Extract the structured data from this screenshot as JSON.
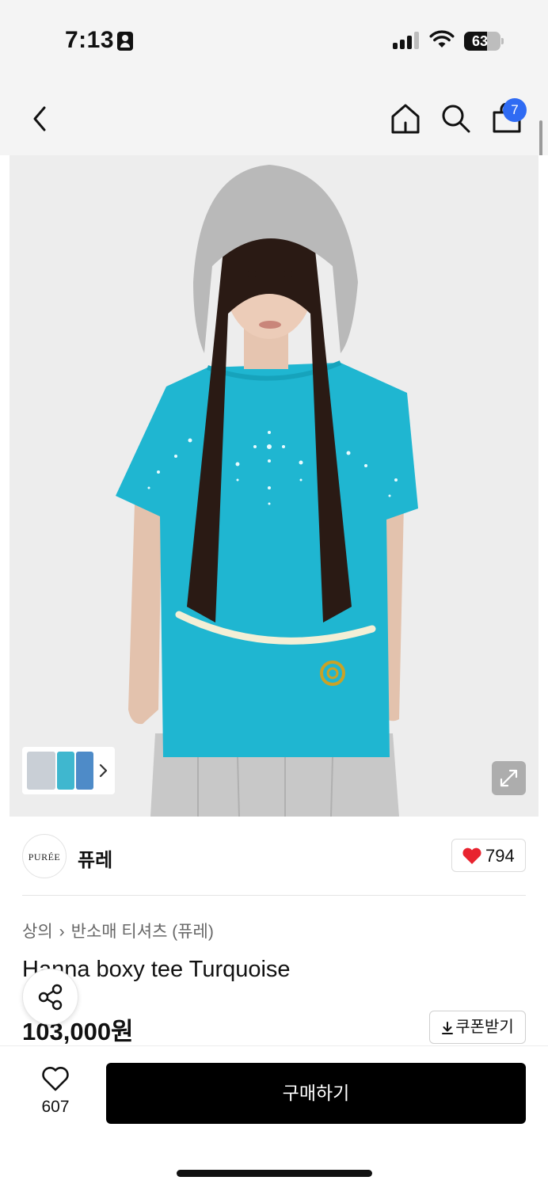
{
  "status_bar": {
    "time": "7:13",
    "battery": "63",
    "battery_level": 0.63
  },
  "nav": {
    "cart_badge": "7"
  },
  "brand": {
    "logo_text": "PURÉE",
    "name": "퓨레",
    "like_count": "794"
  },
  "product": {
    "breadcrumb": [
      "상의",
      "반소매 티셔츠 (퓨레)"
    ],
    "title": "Hanna boxy tee Turquoise",
    "price": "103,000원",
    "coupon_label": "쿠폰받기"
  },
  "bottom": {
    "wish_count": "607",
    "buy_label": "구매하기"
  },
  "colors": {
    "accent_blue": "#2f6bf3",
    "heart_red": "#e8232f",
    "shirt_turquoise": "#1fb6d1",
    "buy_button": "#000000"
  },
  "icons": [
    "back-icon",
    "home-icon",
    "search-icon",
    "shopping-bag-icon",
    "chevron-right-icon",
    "expand-icon",
    "heart-icon",
    "download-icon",
    "share-icon",
    "heart-outline-icon"
  ]
}
